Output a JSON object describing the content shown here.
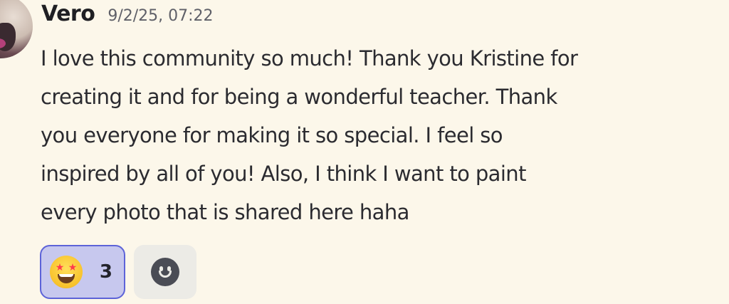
{
  "message": {
    "author": "Vero",
    "timestamp": "9/2/25, 07:22",
    "lines": [
      "I love this community so much! Thank you Kristine for",
      "creating it and for being a wonderful teacher. Thank",
      "you everyone for making it so special. I feel so",
      "inspired by all of you! Also, I think I want to paint",
      "every photo that is shared here haha"
    ]
  },
  "reactions": [
    {
      "icon": "star-struck-emoji-icon",
      "count": "3",
      "active": true
    }
  ],
  "add_reaction": {
    "icon": "add-reaction-smiley-icon"
  },
  "colors": {
    "background": "#fcf7ea",
    "reaction_active_bg": "#c7c8ee",
    "reaction_active_border": "#5d63d8",
    "username": "#1f1f23",
    "timestamp": "#5f6068"
  }
}
